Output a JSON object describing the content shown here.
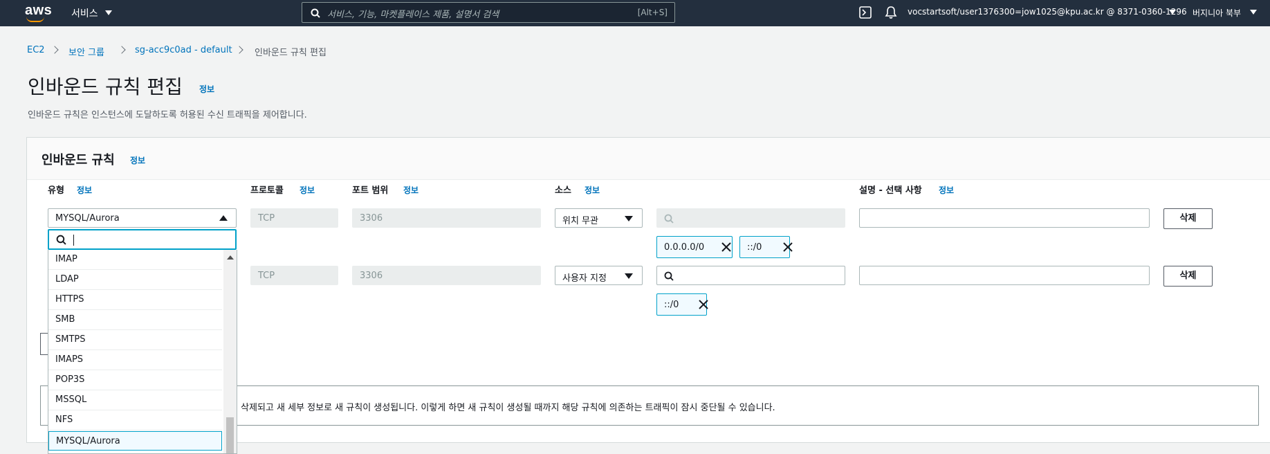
{
  "nav": {
    "logo": "aws",
    "services": "서비스",
    "search_placeholder": "서비스, 기능, 마켓플레이스 제품, 설명서 검색",
    "search_shortcut": "[Alt+S]",
    "account": "vocstartsoft/user1376300=jow1025@kpu.ac.kr @ 8371-0360-1296",
    "region": "버지니아 북부"
  },
  "breadcrumb": [
    "EC2",
    "보안 그룹",
    "sg-acc9c0ad - default",
    "인바운드 규칙 편집"
  ],
  "page": {
    "title": "인바운드 규칙 편집",
    "info": "정보",
    "description": "인바운드 규칙은 인스턴스에 도달하도록 허용된 수신 트래픽을 제어합니다."
  },
  "section": {
    "title": "인바운드 규칙",
    "info": "정보"
  },
  "columns": {
    "type": "유형",
    "protocol": "프로토콜",
    "port": "포트 범위",
    "source": "소스",
    "description": "설명 - 선택 사항",
    "info": "정보"
  },
  "rows": [
    {
      "type": "MYSQL/Aurora",
      "protocol": "TCP",
      "port": "3306",
      "source": "위치 무관",
      "tokens": [
        "0.0.0.0/0",
        "::/0"
      ],
      "delete": "삭제"
    },
    {
      "type": "MYSQL/Aurora",
      "protocol": "TCP",
      "port": "3306",
      "source": "사용자 지정",
      "tokens": [
        "::/0"
      ],
      "delete": "삭제"
    }
  ],
  "dropdown": {
    "options": [
      "IMAP",
      "LDAP",
      "HTTPS",
      "SMB",
      "SMTPS",
      "IMAPS",
      "POP3S",
      "MSSQL",
      "NFS",
      "MYSQL/Aurora"
    ],
    "selected": "MYSQL/Aurora"
  },
  "alert": {
    "text": "칙이 삭제되고 새 세부 정보로 새 규칙이 생성됩니다. 이렇게 하면 새 규칙이 생성될 때까지 해당 규칙에 의존하는 트래픽이 잠시 중단될 수 있습니다."
  },
  "colors": {
    "nav_bg": "#232f3e",
    "link": "#0073bb",
    "accent": "#00a1c9",
    "orange": "#ff9900"
  }
}
